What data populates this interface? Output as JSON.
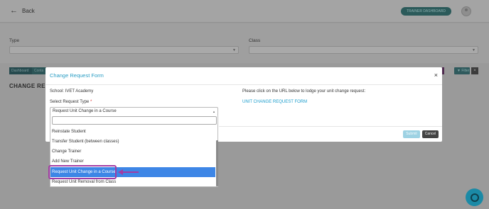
{
  "header": {
    "back_label": "Back",
    "trainer_dashboard_label": "TRAINER DASHBOARD"
  },
  "filters": {
    "type_label": "Type",
    "class_label": "Class"
  },
  "background": {
    "tab1_label": "Dashboard",
    "tab2_label": "Conta",
    "filter_label": "Filter",
    "clear_label": "×",
    "heading": "CHANGE REQU"
  },
  "modal": {
    "title": "Change Request Form",
    "close_label": "×",
    "school_label": "School: IVET Academy",
    "request_type_label": "Select Request Type",
    "required_mark": "*",
    "selected_value": "Request Unit Change in a Course",
    "lodge_text": "Please click on the URL below to lodge your unit change request:",
    "link_text": "UNIT CHANGE REQUEST FORM",
    "submit_label": "Submit",
    "cancel_label": "Cancel"
  },
  "dropdown": {
    "search_value": "",
    "options": [
      "Reinstate Student",
      "Transfer Student (between classes)",
      "Change Trainer",
      "Add New Trainer",
      "Request Unit Change in a Course",
      "Request Unit Removal from Class"
    ],
    "selected_index": 4
  },
  "colors": {
    "accent": "#2a9dc4",
    "selection": "#3d86e6",
    "highlight": "#a23ca4"
  }
}
